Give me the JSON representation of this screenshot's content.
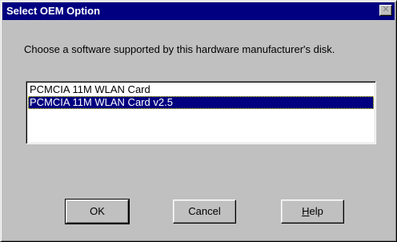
{
  "window": {
    "title": "Select OEM Option",
    "close_glyph": "✕"
  },
  "prompt": "Choose a software supported by this hardware manufacturer's disk.",
  "options": [
    {
      "label": "PCMCIA 11M WLAN Card",
      "selected": false
    },
    {
      "label": "PCMCIA 11M WLAN Card v2.5",
      "selected": true
    }
  ],
  "buttons": {
    "ok": "OK",
    "cancel": "Cancel",
    "help_accel": "H",
    "help_rest": "elp"
  },
  "colors": {
    "titlebar": "#000080",
    "face": "#c0c0c0",
    "selection": "#000080"
  }
}
